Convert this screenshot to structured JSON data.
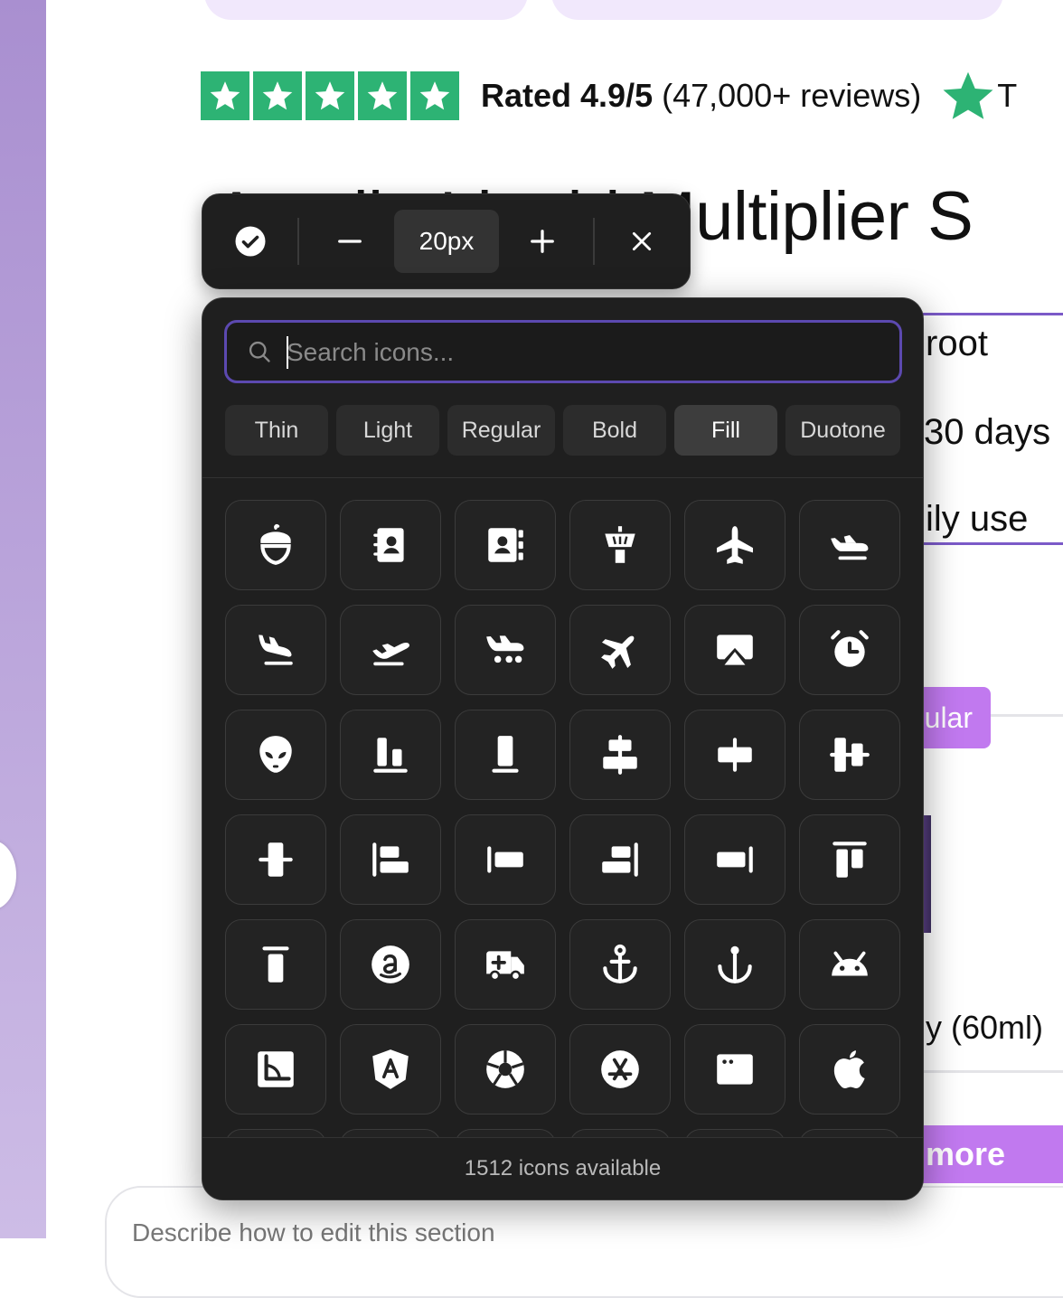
{
  "rating": {
    "bold_label": "Rated 4.9/5",
    "reviews_label": "(47,000+ reviews)",
    "trailing_letter": "T",
    "stars": 5,
    "brand_color": "#2db374"
  },
  "page": {
    "heading": "Amplia Liquid Multiplier S",
    "bg_texts": {
      "root": "root",
      "days": "30 days",
      "daily_use": "ily use",
      "regular": "ular",
      "size_ml": "y (60ml)",
      "more": "more"
    },
    "describe_placeholder": "Describe how to edit this section"
  },
  "toolbar": {
    "size_value": "20px",
    "confirm_icon": "check-circle-icon",
    "decrease_icon": "minus-icon",
    "increase_icon": "plus-icon",
    "close_icon": "close-icon"
  },
  "picker": {
    "search_placeholder": "Search icons...",
    "weights": [
      "Thin",
      "Light",
      "Regular",
      "Bold",
      "Fill",
      "Duotone"
    ],
    "active_weight": "Fill",
    "accent_color": "#5c49b0",
    "icons": [
      "acorn-icon",
      "address-book-icon",
      "address-book-tabs-icon",
      "air-traffic-control-icon",
      "airplane-icon",
      "airplane-in-flight-icon",
      "airplane-landing-icon",
      "airplane-takeoff-icon",
      "airplane-taxiing-icon",
      "airplane-tilt-icon",
      "airplay-icon",
      "alarm-icon",
      "alien-icon",
      "align-bottom-icon",
      "align-bottom-simple-icon",
      "align-center-horizontal-icon",
      "align-center-horizontal-simple-icon",
      "align-center-vertical-icon",
      "align-center-vertical-simple-icon",
      "align-left-icon",
      "align-left-simple-icon",
      "align-right-icon",
      "align-right-simple-icon",
      "align-top-icon",
      "align-top-simple-icon",
      "amazon-logo-icon",
      "ambulance-icon",
      "anchor-icon",
      "anchor-simple-icon",
      "android-logo-icon",
      "angle-icon",
      "angular-logo-icon",
      "aperture-icon",
      "app-store-logo-icon",
      "app-window-icon",
      "apple-logo-icon"
    ],
    "footer": "1512 icons available"
  }
}
